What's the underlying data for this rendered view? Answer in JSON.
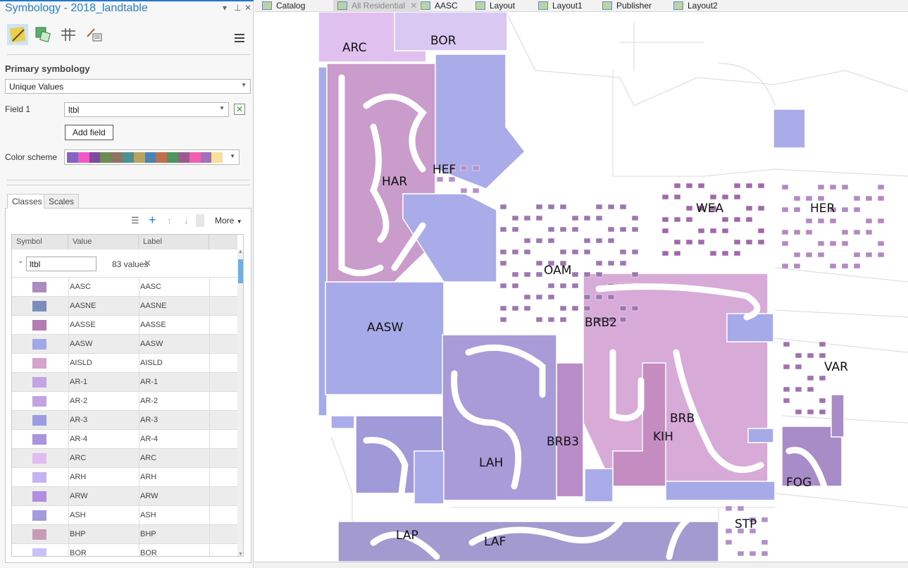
{
  "panel": {
    "title": "Symbology - 2018_landtable",
    "controls": [
      "▾",
      "⊥",
      "✕"
    ],
    "tools": [
      "primary-symbology",
      "vary-symbology",
      "symbol-layers",
      "label-symbology"
    ],
    "section_title": "Primary symbology",
    "renderer": "Unique Values",
    "field1_label": "Field 1",
    "field1_value": "ltbl",
    "add_field": "Add field",
    "color_scheme_label": "Color scheme",
    "color_scheme": [
      "#8464c0",
      "#f058c8",
      "#7c4ca0",
      "#6c8c50",
      "#8c7460",
      "#4c9090",
      "#b8a460",
      "#4c84b0",
      "#c07048",
      "#4c9460",
      "#a05890",
      "#f060b0",
      "#a070b8",
      "#f8e098"
    ],
    "tabs": [
      "Classes",
      "Scales"
    ],
    "toolbar": {
      "more": "More"
    },
    "columns": [
      "Symbol",
      "Value",
      "Label"
    ],
    "group": {
      "field": "ltbl",
      "count": "83 values"
    },
    "classes": [
      {
        "value": "AASC",
        "label": "AASC",
        "color": "#a88cc0"
      },
      {
        "value": "AASNE",
        "label": "AASNE",
        "color": "#7c8cbc"
      },
      {
        "value": "AASSE",
        "label": "AASSE",
        "color": "#b47cb4"
      },
      {
        "value": "AASW",
        "label": "AASW",
        "color": "#a0a8e8"
      },
      {
        "value": "AISLD",
        "label": "AISLD",
        "color": "#d4a4cc"
      },
      {
        "value": "AR-1",
        "label": "AR-1",
        "color": "#c4a4e4"
      },
      {
        "value": "AR-2",
        "label": "AR-2",
        "color": "#c4a4e0"
      },
      {
        "value": "AR-3",
        "label": "AR-3",
        "color": "#9c9ce4"
      },
      {
        "value": "AR-4",
        "label": "AR-4",
        "color": "#ac94dc"
      },
      {
        "value": "ARC",
        "label": "ARC",
        "color": "#e0bcf0"
      },
      {
        "value": "ARH",
        "label": "ARH",
        "color": "#c4b4f0"
      },
      {
        "value": "ARW",
        "label": "ARW",
        "color": "#b48ce0"
      },
      {
        "value": "ASH",
        "label": "ASH",
        "color": "#a49cdc"
      },
      {
        "value": "BHP",
        "label": "BHP",
        "color": "#c89cb8"
      },
      {
        "value": "BOR",
        "label": "BOR",
        "color": "#c8c0f8"
      }
    ]
  },
  "map_tabs": [
    {
      "label": "Catalog",
      "active": false
    },
    {
      "label": "All Residential",
      "active": true
    },
    {
      "label": "AASC",
      "active": false
    },
    {
      "label": "Layout",
      "active": false
    },
    {
      "label": "Layout1",
      "active": false
    },
    {
      "label": "Publisher",
      "active": false
    },
    {
      "label": "Layout2",
      "active": false
    }
  ],
  "map_labels": [
    "ARC",
    "BOR",
    "HAR",
    "HEF",
    "WEA",
    "HER",
    "OAM",
    "BRB2",
    "AASW",
    "VAR",
    "BRB",
    "KIH",
    "BRB3",
    "LAH",
    "FOG",
    "STP",
    "LAP",
    "LAF"
  ]
}
